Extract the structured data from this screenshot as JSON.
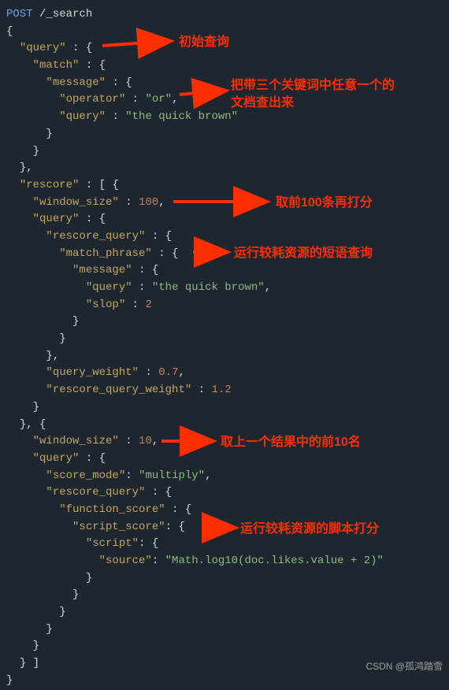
{
  "http": {
    "method": "POST",
    "path": "/_search"
  },
  "keys": {
    "query": "\"query\"",
    "match": "\"match\"",
    "message": "\"message\"",
    "operator": "\"operator\"",
    "queryk": "\"query\"",
    "rescore": "\"rescore\"",
    "window_size": "\"window_size\"",
    "rescore_query": "\"rescore_query\"",
    "match_phrase": "\"match_phrase\"",
    "slop": "\"slop\"",
    "query_weight": "\"query_weight\"",
    "rescore_query_weight": "\"rescore_query_weight\"",
    "score_mode": "\"score_mode\"",
    "function_score": "\"function_score\"",
    "script_score": "\"script_score\"",
    "script": "\"script\"",
    "source": "\"source\""
  },
  "strings": {
    "or": "\"or\"",
    "quick": "\"the quick brown\"",
    "multiply": "\"multiply\"",
    "mathlog": "\"Math.log10(doc.likes.value + 2)\""
  },
  "nums": {
    "n100": "100",
    "n2": "2",
    "n07": "0.7",
    "n12": "1.2",
    "n10": "10"
  },
  "annotations": {
    "a1": "初始查询",
    "a2": "把带三个关键词中任意一个的文档查出来",
    "a3": "取前100条再打分",
    "a4": "运行较耗资源的短语查询",
    "a5": "取上一个结果中的前10名",
    "a6": "运行较耗资源的脚本打分"
  },
  "watermark": "CSDN @孤鸿踏雪"
}
